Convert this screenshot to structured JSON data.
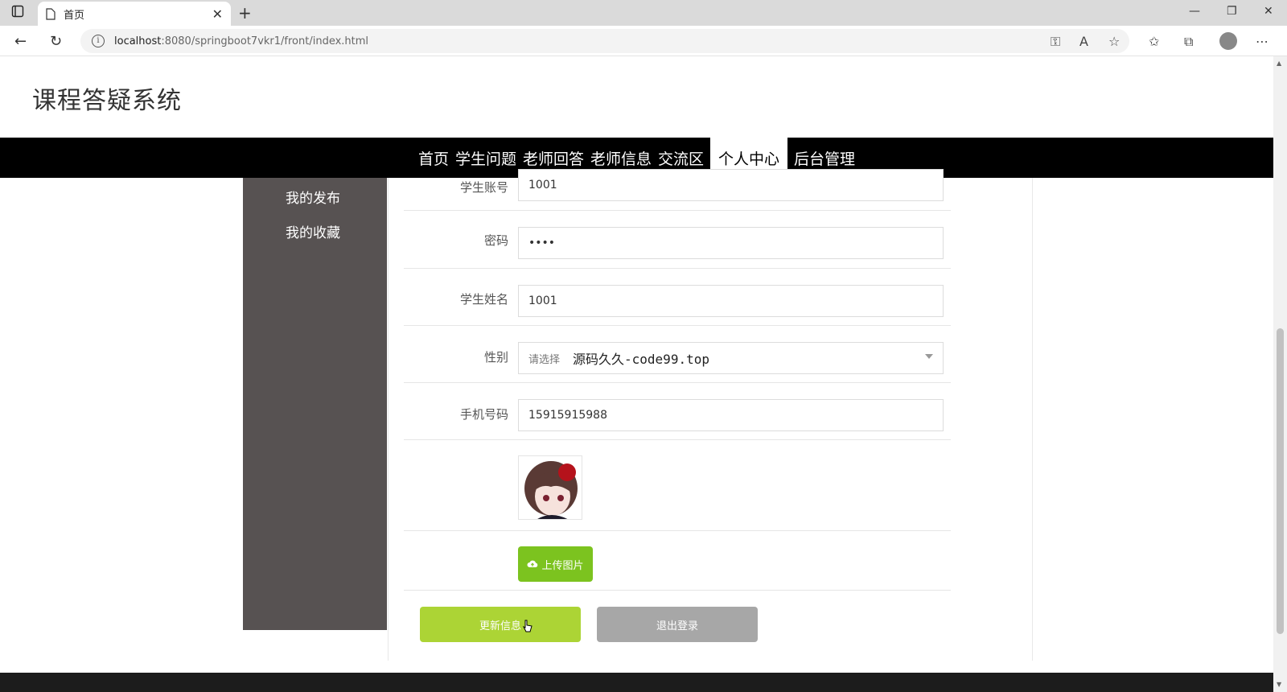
{
  "browser": {
    "tab_title": "首页",
    "url_host": "localhost",
    "url_rest": ":8080/springboot7vkr1/front/index.html"
  },
  "site": {
    "title": "课程答疑系统",
    "nav": [
      {
        "label": "首页"
      },
      {
        "label": "学生问题"
      },
      {
        "label": "老师回答"
      },
      {
        "label": "老师信息"
      },
      {
        "label": "交流区"
      },
      {
        "label": "个人中心",
        "active": true
      },
      {
        "label": "后台管理"
      }
    ]
  },
  "sidebar": {
    "items": [
      {
        "label": "我的发布"
      },
      {
        "label": "我的收藏"
      }
    ]
  },
  "form": {
    "account": {
      "label": "学生账号",
      "value": "1001"
    },
    "password": {
      "label": "密码",
      "value": "••••"
    },
    "name": {
      "label": "学生姓名",
      "value": "1001"
    },
    "gender": {
      "label": "性别",
      "placeholder": "请选择",
      "value": "源码久久-code99.top"
    },
    "phone": {
      "label": "手机号码",
      "value": "15915915988"
    }
  },
  "buttons": {
    "upload": "上传图片",
    "update": "更新信息",
    "logout": "退出登录"
  },
  "colors": {
    "nav_bg": "#000000",
    "sidebar_bg": "#575252",
    "upload_btn": "#7cc31f",
    "update_btn": "#acd435",
    "logout_btn": "#a7a7a7"
  }
}
